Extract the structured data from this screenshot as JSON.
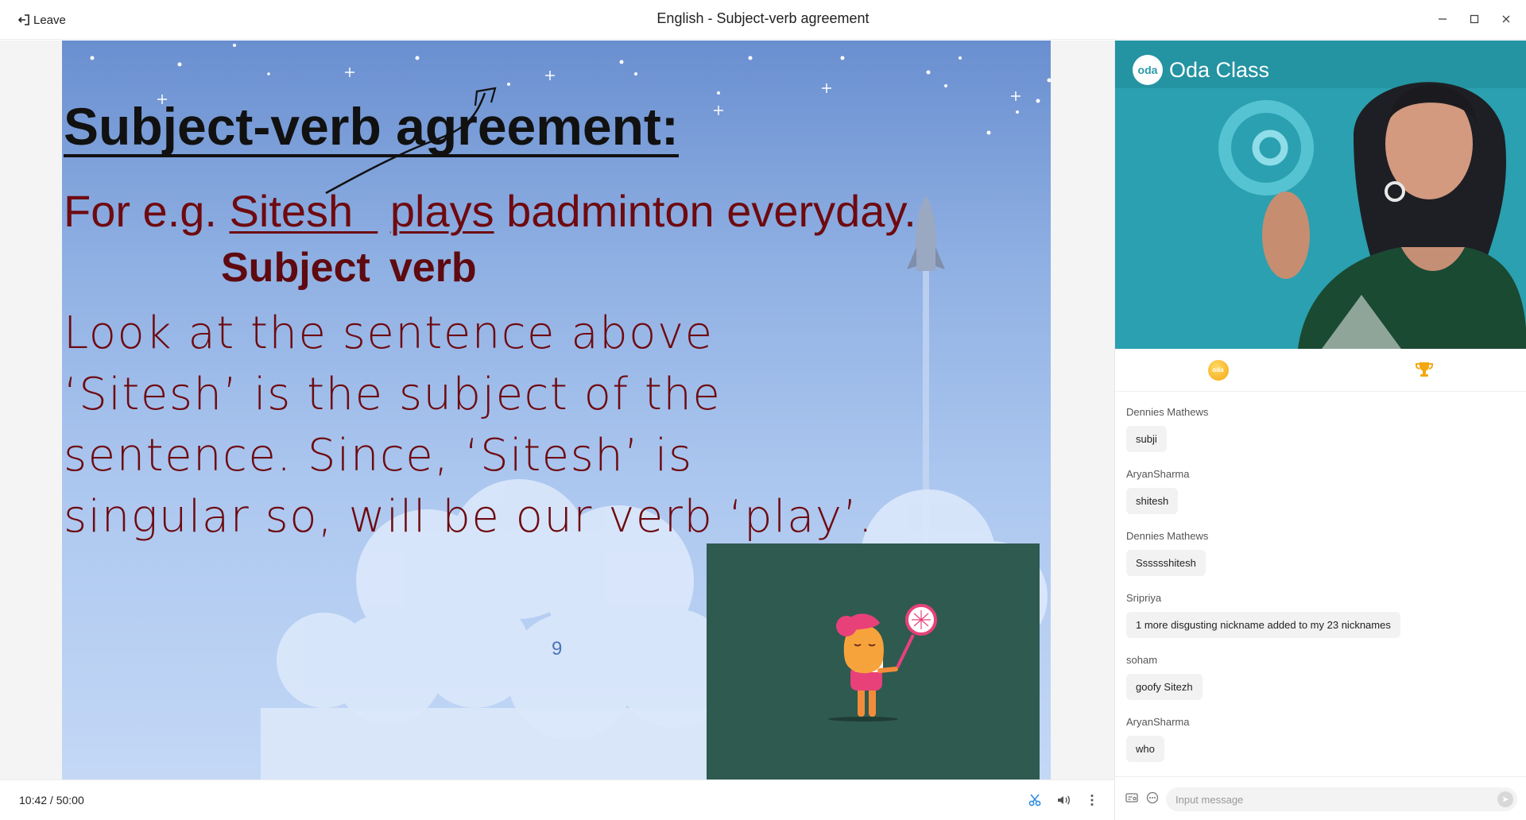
{
  "window": {
    "title": "English - Subject-verb agreement",
    "leave_label": "Leave"
  },
  "slide": {
    "heading": "Subject-verb agreement:",
    "example_prefix": "For e.g. ",
    "example_subject": "Sitesh  ",
    "example_verb": "plays",
    "example_suffix": " badminton everyday.",
    "label_subject": "Subject",
    "label_verb": "verb",
    "explanation": "Look at the sentence above ‘Sitesh’ is the subject of the sentence. Since, ‘Sitesh’ is singular so, will be our verb ‘play’.",
    "page_number": "9"
  },
  "player": {
    "time_elapsed": "10:42",
    "time_separator": " / ",
    "time_total": "50:00"
  },
  "video": {
    "brand_logo_text": "oda",
    "brand_name": "Oda Class"
  },
  "tabs": {
    "coin_text": "oda"
  },
  "chat": {
    "messages": [
      {
        "name": "Dennies Mathews",
        "text": "subji"
      },
      {
        "name": "AryanSharma",
        "text": "shitesh"
      },
      {
        "name": "Dennies Mathews",
        "text": "Sssssshitesh"
      },
      {
        "name": "Sripriya",
        "text": "1 more disgusting nickname added to my 23 nicknames"
      },
      {
        "name": "soham",
        "text": "goofy Sitezh"
      },
      {
        "name": "AryanSharma",
        "text": "who"
      }
    ],
    "input_placeholder": "Input message"
  },
  "colors": {
    "accent_blue": "#2f8de0",
    "slide_text": "#6e0a10",
    "anim_bg": "#2f5a4f",
    "trophy": "#f3a712"
  }
}
